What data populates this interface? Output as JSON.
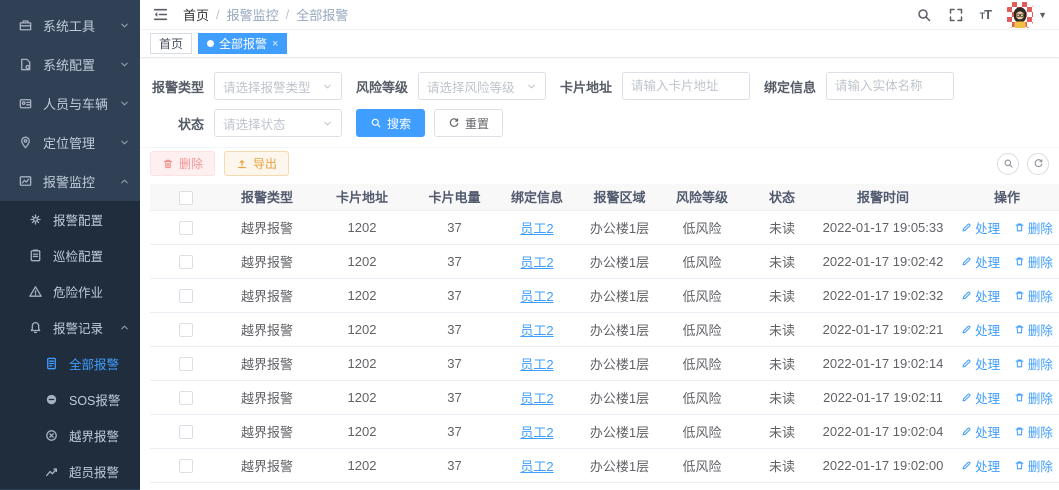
{
  "app": {
    "accent": "#409eff",
    "danger": "#f56c6c",
    "warning": "#e6a23c",
    "sidebar_bg": "#304156",
    "submenu_bg": "#1f2d3d"
  },
  "sidebar": {
    "items": [
      {
        "label": "系统工具",
        "icon": "toolbox-icon"
      },
      {
        "label": "系统配置",
        "icon": "file-gear-icon"
      },
      {
        "label": "人员与车辆",
        "icon": "id-card-icon"
      },
      {
        "label": "定位管理",
        "icon": "location-pin-icon"
      },
      {
        "label": "报警监控",
        "icon": "monitor-chart-icon",
        "expanded": true
      }
    ],
    "submenu": [
      {
        "label": "报警配置",
        "icon": "gear-icon"
      },
      {
        "label": "巡检配置",
        "icon": "clipboard-icon"
      },
      {
        "label": "危险作业",
        "icon": "warning-triangle-icon"
      },
      {
        "label": "报警记录",
        "icon": "bell-icon",
        "expanded": true
      }
    ],
    "sub_submenu": [
      {
        "label": "全部报警",
        "icon": "document-icon",
        "active": true
      },
      {
        "label": "SOS报警",
        "icon": "sos-circle-icon"
      },
      {
        "label": "越界报警",
        "icon": "circle-x-icon"
      },
      {
        "label": "超员报警",
        "icon": "trend-up-icon"
      }
    ]
  },
  "navbar": {
    "breadcrumb": [
      "首页",
      "报警监控",
      "全部报警"
    ],
    "separator": "/"
  },
  "tabs": {
    "home": "首页",
    "active": "全部报警",
    "close_glyph": "×"
  },
  "filters": {
    "alarm_type": {
      "label": "报警类型",
      "placeholder": "请选择报警类型"
    },
    "risk_level": {
      "label": "风险等级",
      "placeholder": "请选择风险等级"
    },
    "card_address": {
      "label": "卡片地址",
      "placeholder": "请输入卡片地址"
    },
    "bind_info": {
      "label": "绑定信息",
      "placeholder": "请输入实体名称"
    },
    "status": {
      "label": "状态",
      "placeholder": "请选择状态"
    },
    "search_label": "搜索",
    "reset_label": "重置"
  },
  "toolbar": {
    "delete_label": "删除",
    "export_label": "导出"
  },
  "table": {
    "columns": [
      "报警类型",
      "卡片地址",
      "卡片电量",
      "绑定信息",
      "报警区域",
      "风险等级",
      "状态",
      "报警时间",
      "操作"
    ],
    "actions": {
      "handle": "处理",
      "delete": "删除"
    },
    "rows": [
      {
        "type": "越界报警",
        "card": "1202",
        "battery": "37",
        "bind": "员工2",
        "area": "办公楼1层",
        "risk": "低风险",
        "status": "未读",
        "time": "2022-01-17 19:05:33"
      },
      {
        "type": "越界报警",
        "card": "1202",
        "battery": "37",
        "bind": "员工2",
        "area": "办公楼1层",
        "risk": "低风险",
        "status": "未读",
        "time": "2022-01-17 19:02:42"
      },
      {
        "type": "越界报警",
        "card": "1202",
        "battery": "37",
        "bind": "员工2",
        "area": "办公楼1层",
        "risk": "低风险",
        "status": "未读",
        "time": "2022-01-17 19:02:32"
      },
      {
        "type": "越界报警",
        "card": "1202",
        "battery": "37",
        "bind": "员工2",
        "area": "办公楼1层",
        "risk": "低风险",
        "status": "未读",
        "time": "2022-01-17 19:02:21"
      },
      {
        "type": "越界报警",
        "card": "1202",
        "battery": "37",
        "bind": "员工2",
        "area": "办公楼1层",
        "risk": "低风险",
        "status": "未读",
        "time": "2022-01-17 19:02:14"
      },
      {
        "type": "越界报警",
        "card": "1202",
        "battery": "37",
        "bind": "员工2",
        "area": "办公楼1层",
        "risk": "低风险",
        "status": "未读",
        "time": "2022-01-17 19:02:11"
      },
      {
        "type": "越界报警",
        "card": "1202",
        "battery": "37",
        "bind": "员工2",
        "area": "办公楼1层",
        "risk": "低风险",
        "status": "未读",
        "time": "2022-01-17 19:02:04"
      },
      {
        "type": "越界报警",
        "card": "1202",
        "battery": "37",
        "bind": "员工2",
        "area": "办公楼1层",
        "risk": "低风险",
        "status": "未读",
        "time": "2022-01-17 19:02:00"
      }
    ]
  }
}
